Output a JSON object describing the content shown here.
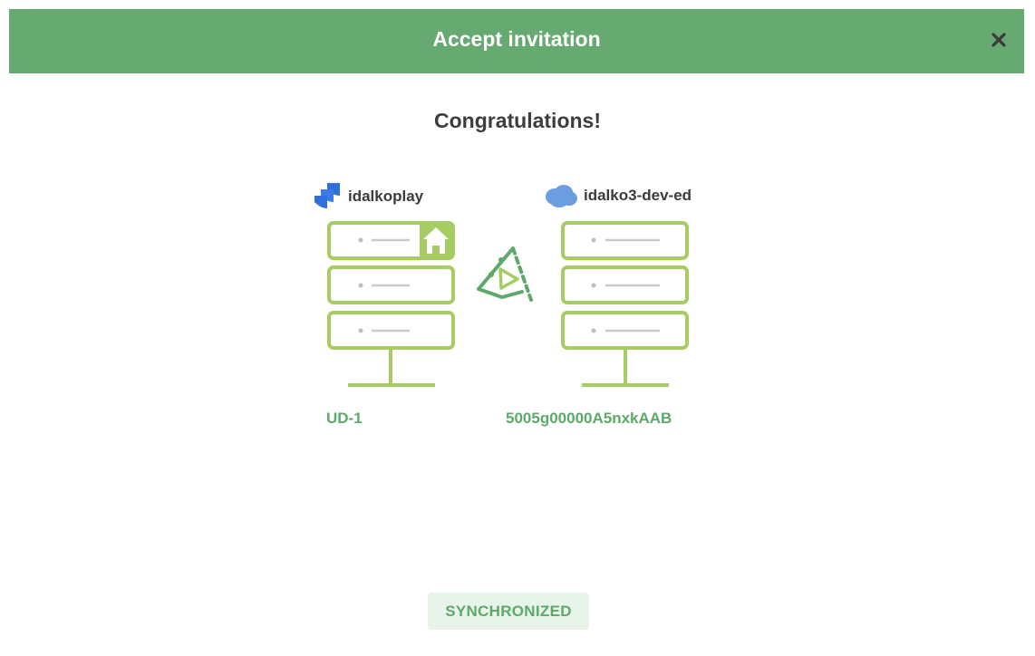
{
  "dialog": {
    "title": "Accept invitation",
    "close_icon": "close-icon"
  },
  "main": {
    "heading": "Congratulations!",
    "left_instance": {
      "name": "idalkoplay",
      "logo_icon": "jira-icon",
      "issue_key": "UD-1",
      "badge_icon": "home-icon"
    },
    "right_instance": {
      "name": "idalko3-dev-ed",
      "logo_icon": "salesforce-cloud-icon",
      "record_id": "5005g00000A5nxkAAB"
    },
    "connector_icon": "exalate-triangle-icon",
    "status": "SYNCHRONIZED"
  },
  "colors": {
    "header_bg": "#66aa72",
    "server_stroke": "#a6cc63",
    "accent_green": "#5ca96a",
    "status_bg": "#e8f3ea",
    "jira_blue": "#2f6fde",
    "salesforce_blue": "#6a9ee0"
  }
}
